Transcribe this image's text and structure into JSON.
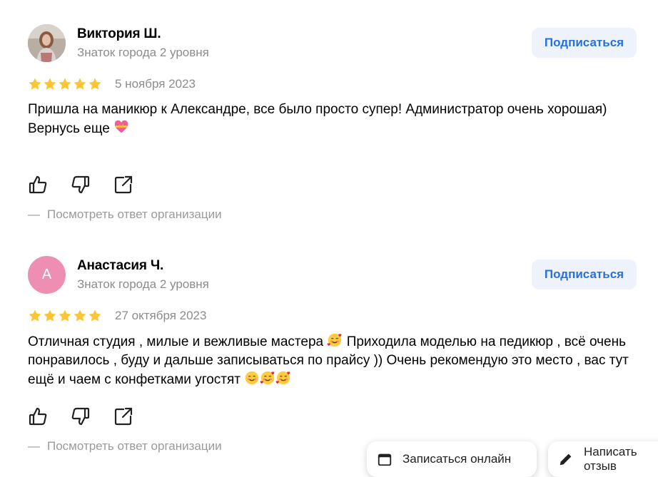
{
  "colors": {
    "star": "#fbc534",
    "accent": "#2670e0",
    "subscribe_bg": "#eef3fb",
    "muted": "#8c8c8c"
  },
  "reviews": [
    {
      "author": "Виктория Ш.",
      "level": "Знаток города 2 уровня",
      "avatar": "photo",
      "rating": 5,
      "subscribe_label": "Подписаться",
      "date": "5 ноября 2023",
      "lines": [
        "Пришла на маникюр к Александре, все было просто супер! Администратор очень хорошая)",
        "Вернусь еще"
      ],
      "emoji": "heart-with-ribbon-emoji",
      "org_answer_label": "Посмотреть ответ организации"
    },
    {
      "author": "Анастасия Ч.",
      "level": "Знаток города 2 уровня",
      "avatar_letter": "А",
      "rating": 5,
      "subscribe_label": "Подписаться",
      "date": "27 октября 2023",
      "text_1": "Отличная студия , милые и вежливые мастера",
      "text_2": "Приходила моделью на педикюр , всё очень понравилось , буду и дальше записываться по прайсу )) Очень рекомендую это место , вас тут ещё и чаем с конфетками угостят",
      "emojis": [
        "smiling-face-with-hearts-emoji",
        "smiling-face-emoji",
        "smiling-face-with-hearts-emoji",
        "smiling-face-with-hearts-emoji"
      ],
      "org_answer_label": "Посмотреть ответ организации"
    }
  ],
  "floating_actions": {
    "book_online": "Записаться онлайн",
    "write_review": "Написать отзыв"
  }
}
